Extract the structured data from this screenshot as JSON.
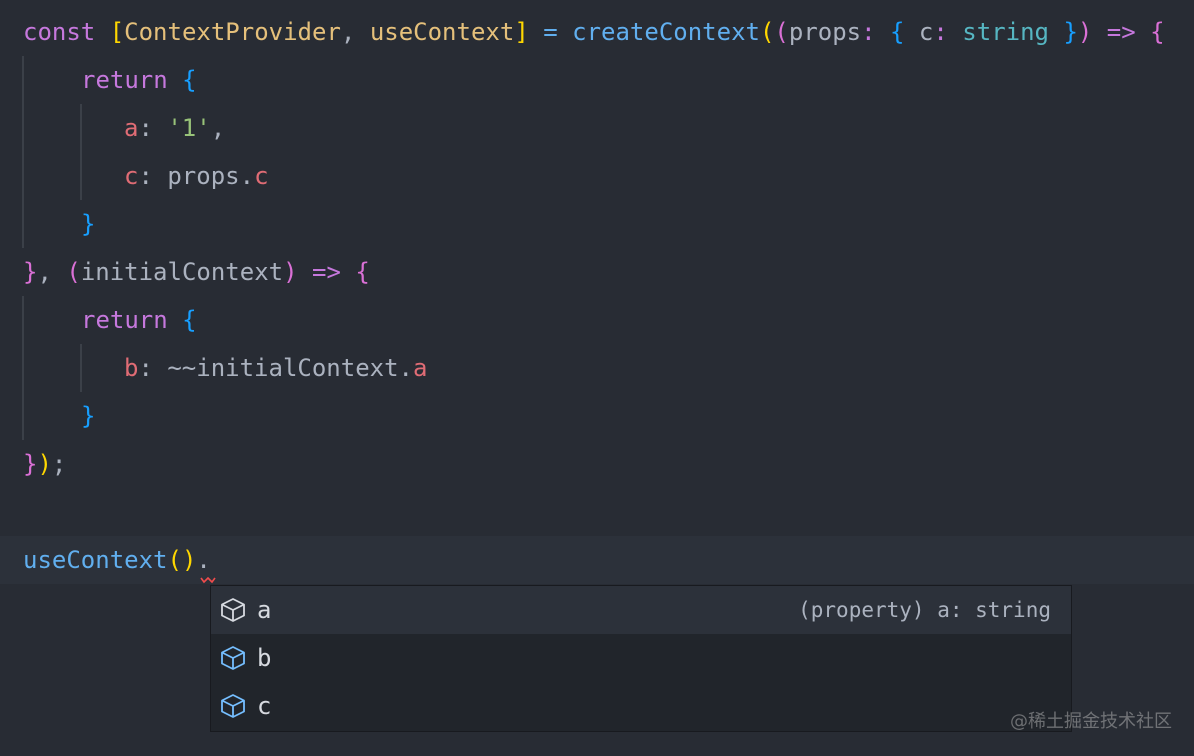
{
  "code": {
    "l1": {
      "const": "const",
      "open_bracket": "[",
      "provider": "ContextProvider",
      "comma": ", ",
      "use_context": "useContext",
      "close_bracket": "]",
      "equals": " = ",
      "create_context": "createContext",
      "paren_open": "(",
      "arg_open": "(",
      "props": "props",
      "colon": ": ",
      "obj_open": "{",
      "c": " c",
      "c_colon": ": ",
      "string": "string",
      "obj_close": " }",
      "arg_close": ")",
      "arrow": " =>",
      "body_open": " {"
    },
    "l2": {
      "return": "return",
      "brace": " {"
    },
    "l3": {
      "key": "a",
      "colon": ": ",
      "value": "'1'",
      "comma": ","
    },
    "l4": {
      "key": "c",
      "colon": ": ",
      "obj": "props.",
      "prop": "c"
    },
    "l5": {
      "brace": "}"
    },
    "l6": {
      "close_brace": "}",
      "comma": ", ",
      "arg_open": "(",
      "param": "initialContext",
      "arg_close": ")",
      "arrow": " =>",
      "body_open": " {"
    },
    "l7": {
      "return": "return",
      "brace": " {"
    },
    "l8": {
      "key": "b",
      "colon": ": ",
      "expr": "~~initialContext.",
      "prop": "a"
    },
    "l9": {
      "brace": "}"
    },
    "l10": {
      "close_brace": "}",
      "paren_close": ")",
      "semi": ";"
    },
    "l12": {
      "fn": "useContext",
      "call_open": "(",
      "call_close": ")",
      "dot": "."
    }
  },
  "suggestions": [
    {
      "label": "a",
      "detail": "(property) a: string",
      "icon": "cube-icon",
      "selected": true
    },
    {
      "label": "b",
      "detail": "",
      "icon": "cube-icon",
      "selected": false
    },
    {
      "label": "c",
      "detail": "",
      "icon": "cube-icon",
      "selected": false
    }
  ],
  "watermark": "@稀土掘金技术社区",
  "colors": {
    "background": "#282c34",
    "keyword": "#c678dd",
    "function": "#61afef",
    "variable": "#e5c07b",
    "property": "#e06c75",
    "string": "#98c379",
    "type": "#56b6c2",
    "bracket_gold": "#ffd700",
    "bracket_orchid": "#da70d6",
    "bracket_blue": "#179fff",
    "error": "#f14c4c"
  }
}
